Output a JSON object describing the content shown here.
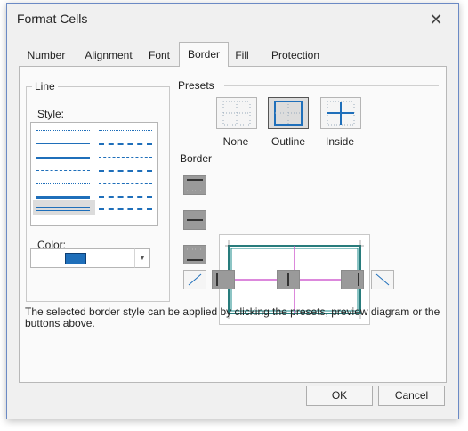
{
  "window": {
    "title": "Format Cells",
    "close_symbol": "✕"
  },
  "tabs": [
    {
      "label": "Number",
      "active": false
    },
    {
      "label": "Alignment",
      "active": false
    },
    {
      "label": "Font",
      "active": false
    },
    {
      "label": "Border",
      "active": true
    },
    {
      "label": "Fill",
      "active": false
    },
    {
      "label": "Protection",
      "active": false
    }
  ],
  "line_group": {
    "label": "Line",
    "style_label": "Style:",
    "color_label": "Color:",
    "selected_style": "double",
    "color_value": "#1f6fba"
  },
  "presets": {
    "label": "Presets",
    "items": [
      {
        "label": "None"
      },
      {
        "label": "Outline"
      },
      {
        "label": "Inside"
      }
    ]
  },
  "border_group": {
    "label": "Border"
  },
  "note": "The selected border style can be applied by clicking the presets, preview diagram or the buttons above.",
  "buttons": {
    "ok": "OK",
    "cancel": "Cancel"
  },
  "colors": {
    "accent": "#1f6fba",
    "preview_line": "#1a8a8a",
    "preview_inner": "#d060d0"
  }
}
